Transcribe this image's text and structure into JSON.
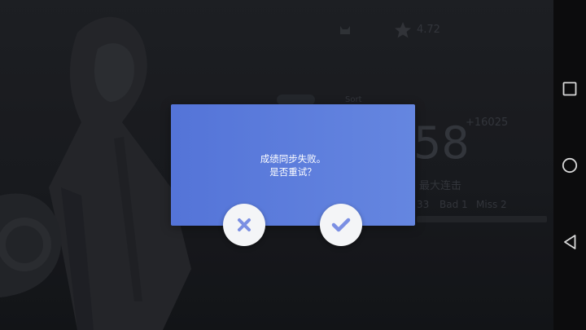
{
  "background": {
    "rating_value": "4.72",
    "score_gain": "+16025",
    "score_digits": "58",
    "max_combo_label": "最大连击",
    "judge_great": "33",
    "judge_bad": "Bad 1",
    "judge_miss": "Miss 2",
    "tab_label": "Sort"
  },
  "dialog": {
    "message_line1": "成绩同步失败。",
    "message_line2": "是否重试？"
  },
  "buttons": {
    "cancel_icon": "close-icon",
    "confirm_icon": "check-icon"
  },
  "navbar": {
    "icons": [
      "recents-square-icon",
      "home-circle-icon",
      "back-triangle-icon"
    ]
  },
  "colors": {
    "dialog_start": "#5474d8",
    "dialog_end": "#6586e0",
    "icon_blue": "#7b8fe3",
    "navbar": "#0c0c0d"
  }
}
